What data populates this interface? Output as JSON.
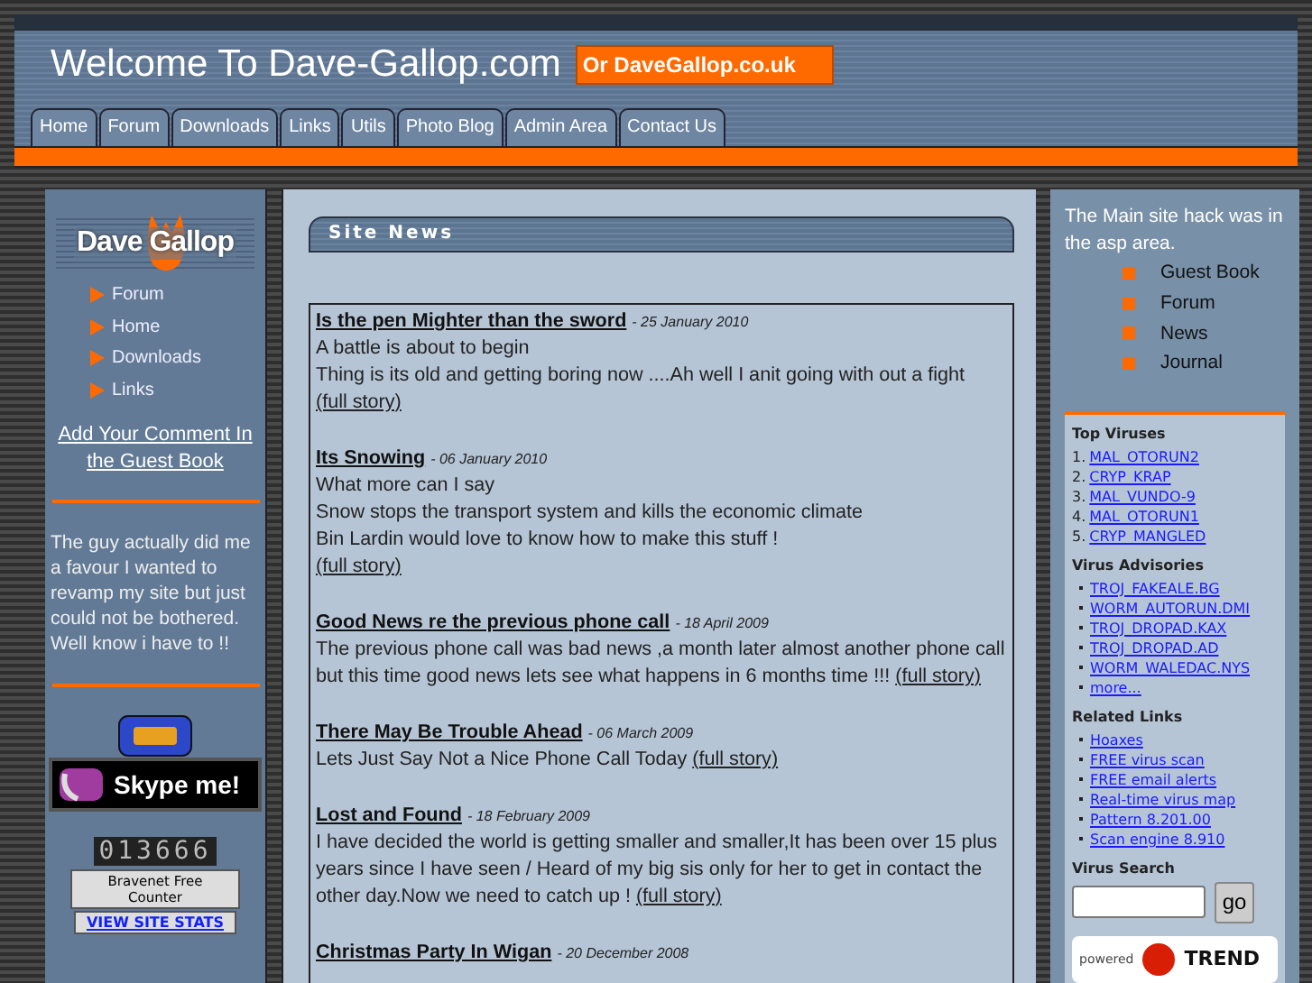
{
  "header": {
    "title": "Welcome To Dave-Gallop.com",
    "alt_domain": "Or DaveGallop.co.uk"
  },
  "tabs": [
    {
      "label": "Home"
    },
    {
      "label": "Forum"
    },
    {
      "label": "Downloads"
    },
    {
      "label": "Links"
    },
    {
      "label": "Utils"
    },
    {
      "label": "Photo Blog"
    },
    {
      "label": "Admin Area"
    },
    {
      "label": "Contact Us"
    }
  ],
  "left_sidebar": {
    "logo": "Dave Gallop",
    "nav": [
      "Forum",
      "Home",
      "Downloads",
      "Links"
    ],
    "guestbook_link": "Add Your Comment In the Guest Book",
    "quote": "The guy actually did me a favour I wanted to revamp my site but just could not be bothered. Well know i have to !!",
    "skype_button": "Skype me!",
    "counter_digits": "013666",
    "counter_label": "Bravenet Free Counter",
    "stats_link": "VIEW SITE STATS"
  },
  "main": {
    "heading": "Site News",
    "news": [
      {
        "title": "Is the pen Mighter than the sword",
        "date": "- 25 January 2010",
        "lines": [
          "A battle is about to begin",
          "Thing is its old and getting boring now ....Ah well I anit going with out a fight"
        ],
        "link": "(full story)",
        "link_inline": false
      },
      {
        "title": "Its Snowing",
        "date": "- 06 January 2010",
        "lines": [
          "What more can I say",
          "Snow stops the transport system and kills the economic climate",
          "Bin Lardin would love to know how to make this stuff !"
        ],
        "link": "(full story)",
        "link_inline": false
      },
      {
        "title": "Good News re the previous phone call",
        "date": "- 18 April 2009",
        "lines": [
          "The previous phone call was bad news ,a month later almost another phone call but this time good news lets see what happens in 6 months time !!!"
        ],
        "link": "(full story)",
        "link_inline": true
      },
      {
        "title": "There May Be Trouble Ahead",
        "date": "- 06 March 2009",
        "lines": [
          "Lets Just Say Not a Nice Phone Call Today"
        ],
        "link": "(full story)",
        "link_inline": true
      },
      {
        "title": "Lost and Found",
        "date": "- 18 February 2009",
        "lines": [
          "I have decided the world is getting smaller and smaller,It has been over 15 plus years since I have seen / Heard of my big sis only for her to get in contact the other day.Now we need to catch up !"
        ],
        "link": "(full story)",
        "link_inline": true
      },
      {
        "title": "Christmas Party In Wigan",
        "date": "- 20 December 2008",
        "link_inline": true
      }
    ]
  },
  "right_sidebar": {
    "hack_note": "The Main site hack was in the asp area.",
    "hack_areas": [
      "Guest Book",
      "Forum",
      "News",
      "Journal"
    ],
    "top_viruses": {
      "heading": "Top Viruses",
      "items": [
        {
          "num": "1.",
          "name": "MAL_OTORUN2"
        },
        {
          "num": "2.",
          "name": "CRYP_KRAP"
        },
        {
          "num": "3.",
          "name": "MAL_VUNDO-9"
        },
        {
          "num": "4.",
          "name": "MAL_OTORUN1"
        },
        {
          "num": "5.",
          "name": "CRYP_MANGLED"
        }
      ]
    },
    "advisories": {
      "heading": "Virus Advisories",
      "items": [
        "TROJ_FAKEALE.BG",
        "WORM_AUTORUN.DMI",
        "TROJ_DROPAD.KAX",
        "TROJ_DROPAD.AD",
        "WORM_WALEDAC.NYS",
        "more..."
      ]
    },
    "related": {
      "heading": "Related Links",
      "items": [
        "Hoaxes",
        "FREE virus scan",
        "FREE email alerts",
        "Real-time virus map",
        "Pattern 8.201.00",
        "Scan engine 8.910"
      ]
    },
    "search": {
      "heading": "Virus Search",
      "button": "go"
    },
    "powered": {
      "label": "powered",
      "brand": "TREND"
    }
  }
}
